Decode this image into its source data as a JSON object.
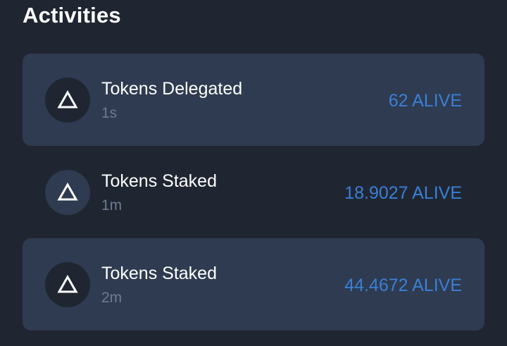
{
  "header": {
    "title": "Activities"
  },
  "activities": [
    {
      "name": "Tokens Delegated",
      "time": "1s",
      "amount": "62 ALIVE",
      "icon": "triangle-icon",
      "highlighted": true
    },
    {
      "name": "Tokens Staked",
      "time": "1m",
      "amount": "18.9027 ALIVE",
      "icon": "triangle-icon",
      "highlighted": false
    },
    {
      "name": "Tokens Staked",
      "time": "2m",
      "amount": "44.4672 ALIVE",
      "icon": "triangle-icon",
      "highlighted": true
    }
  ],
  "colors": {
    "background": "#1f2632",
    "card": "#2e3b50",
    "accent": "#3b7fd6",
    "muted_text": "#6e7b8e"
  }
}
